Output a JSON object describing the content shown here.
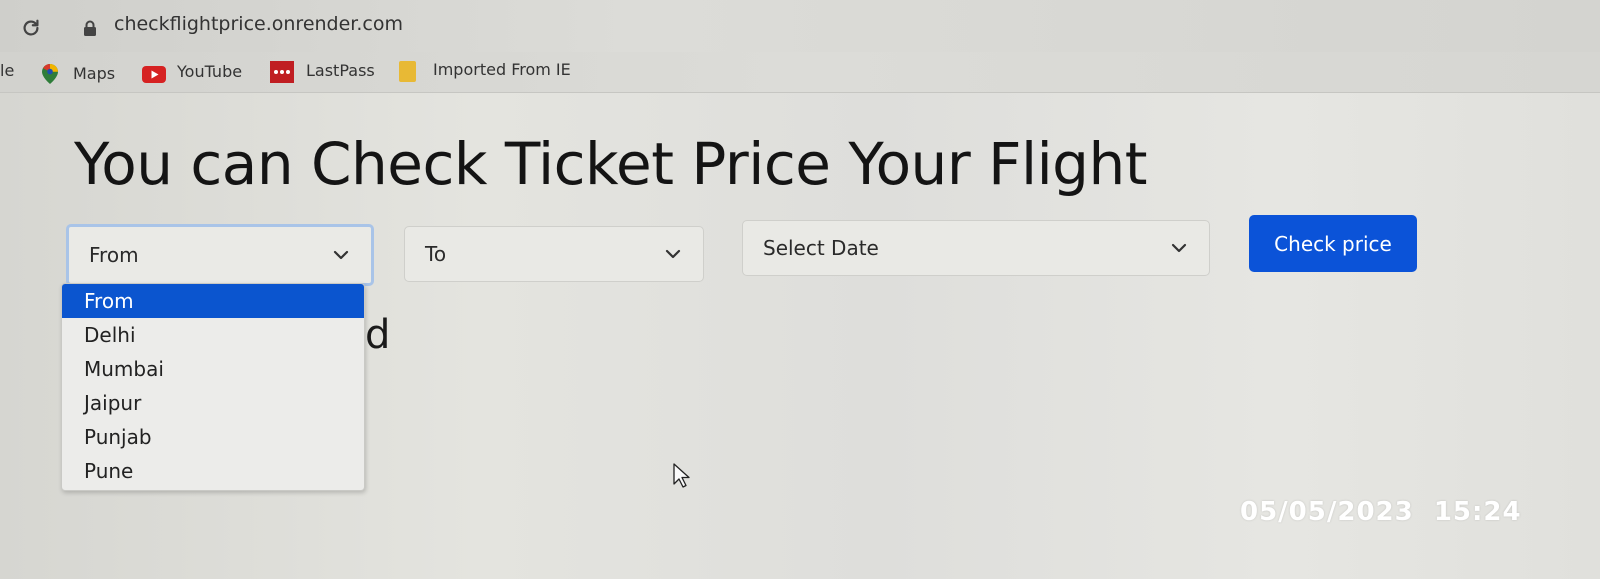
{
  "browser": {
    "url": "checkflightprice.onrender.com",
    "bookmarks": {
      "partial_label": "le",
      "maps": "Maps",
      "youtube": "YouTube",
      "lastpass": "LastPass",
      "imported": "Imported From IE"
    }
  },
  "page": {
    "title": "You can Check Ticket Price Your Flight",
    "partial_text": "d"
  },
  "form": {
    "from_label": "From",
    "to_label": "To",
    "date_label": "Select Date",
    "check_button": "Check price",
    "from_options": [
      "From",
      "Delhi",
      "Mumbai",
      "Jaipur",
      "Punjab",
      "Pune"
    ],
    "selected_index": 0
  },
  "photo_stamp": {
    "date": "05/05/2023",
    "time": "15:24"
  },
  "colors": {
    "button_bg": "#0b53d8",
    "option_highlight": "#0b55cf",
    "focus_ring": "#a9c4e8"
  }
}
